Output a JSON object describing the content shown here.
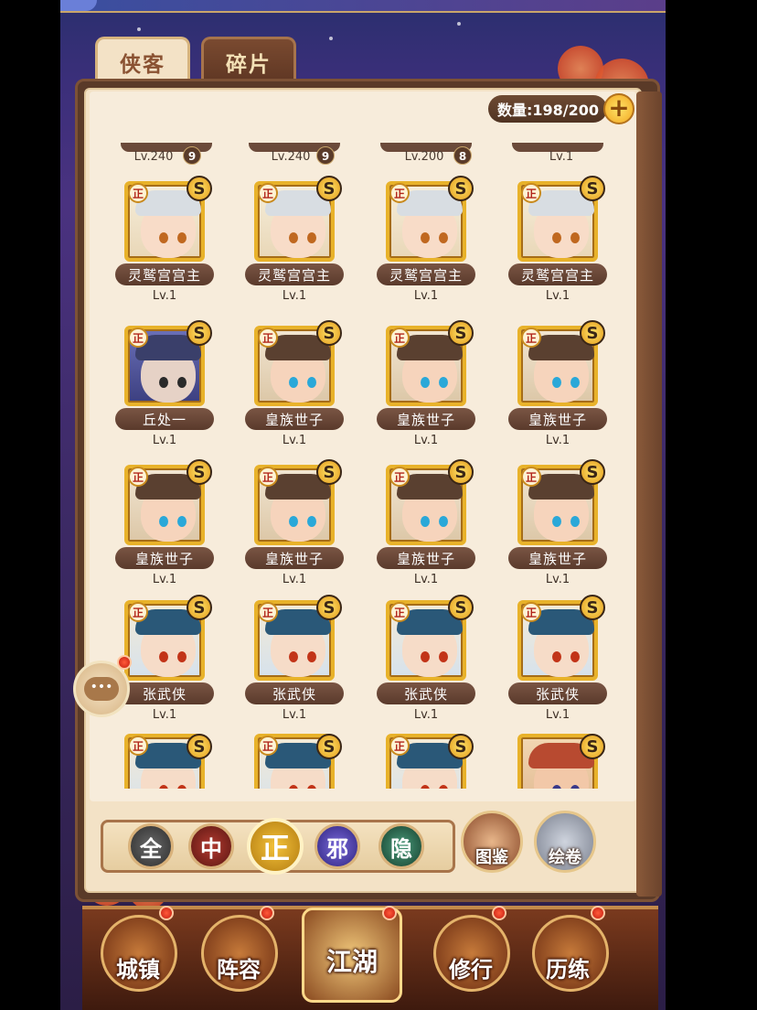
{
  "tabs": [
    {
      "label": "侠客",
      "active": true
    },
    {
      "label": "碎片",
      "active": false
    }
  ],
  "count": {
    "text": "数量:198/200",
    "plus_icon": "plus-icon"
  },
  "partial_row": [
    {
      "level": "Lv.240",
      "stars": "9"
    },
    {
      "level": "Lv.240",
      "stars": "9"
    },
    {
      "level": "Lv.200",
      "stars": "8"
    },
    {
      "level": "Lv.1"
    }
  ],
  "heroes": [
    {
      "name": "灵鹫宫宫主",
      "level": "Lv.1",
      "faction": "正",
      "grade": "S",
      "look": "monk"
    },
    {
      "name": "灵鹫宫宫主",
      "level": "Lv.1",
      "faction": "正",
      "grade": "S",
      "look": "monk"
    },
    {
      "name": "灵鹫宫宫主",
      "level": "Lv.1",
      "faction": "正",
      "grade": "S",
      "look": "monk"
    },
    {
      "name": "灵鹫宫宫主",
      "level": "Lv.1",
      "faction": "正",
      "grade": "S",
      "look": "monk"
    },
    {
      "name": "丘处一",
      "level": "Lv.1",
      "faction": "正",
      "grade": "S",
      "look": "elder"
    },
    {
      "name": "皇族世子",
      "level": "Lv.1",
      "faction": "正",
      "grade": "S",
      "look": "prince"
    },
    {
      "name": "皇族世子",
      "level": "Lv.1",
      "faction": "正",
      "grade": "S",
      "look": "prince"
    },
    {
      "name": "皇族世子",
      "level": "Lv.1",
      "faction": "正",
      "grade": "S",
      "look": "prince"
    },
    {
      "name": "皇族世子",
      "level": "Lv.1",
      "faction": "正",
      "grade": "S",
      "look": "prince"
    },
    {
      "name": "皇族世子",
      "level": "Lv.1",
      "faction": "正",
      "grade": "S",
      "look": "prince"
    },
    {
      "name": "皇族世子",
      "level": "Lv.1",
      "faction": "正",
      "grade": "S",
      "look": "prince"
    },
    {
      "name": "皇族世子",
      "level": "Lv.1",
      "faction": "正",
      "grade": "S",
      "look": "prince"
    },
    {
      "name": "张武侠",
      "level": "Lv.1",
      "faction": "正",
      "grade": "S",
      "look": "swordsman"
    },
    {
      "name": "张武侠",
      "level": "Lv.1",
      "faction": "正",
      "grade": "S",
      "look": "swordsman"
    },
    {
      "name": "张武侠",
      "level": "Lv.1",
      "faction": "正",
      "grade": "S",
      "look": "swordsman"
    },
    {
      "name": "张武侠",
      "level": "Lv.1",
      "faction": "正",
      "grade": "S",
      "look": "swordsman"
    }
  ],
  "last_row": [
    {
      "faction": "正",
      "grade": "S",
      "look": "swordsman"
    },
    {
      "faction": "正",
      "grade": "S",
      "look": "swordsman"
    },
    {
      "faction": "正",
      "grade": "S",
      "look": "swordsman"
    },
    {
      "grade": "S",
      "look": "warrior"
    }
  ],
  "filters": [
    {
      "label": "全"
    },
    {
      "label": "中"
    },
    {
      "label": "正",
      "selected": true
    },
    {
      "label": "邪"
    },
    {
      "label": "隐"
    }
  ],
  "side_buttons": {
    "atlas": "图鉴",
    "scroll": "绘卷"
  },
  "chat_icon": "chat-bubble-icon",
  "bottom_nav": [
    {
      "label": "城镇"
    },
    {
      "label": "阵容"
    },
    {
      "label": "江湖",
      "active": true
    },
    {
      "label": "修行"
    },
    {
      "label": "历练"
    }
  ],
  "colors": {
    "accent_gold": "#e8b22a",
    "name_plate": "#6b4a3a",
    "panel_paper": "#f7ecdb"
  }
}
